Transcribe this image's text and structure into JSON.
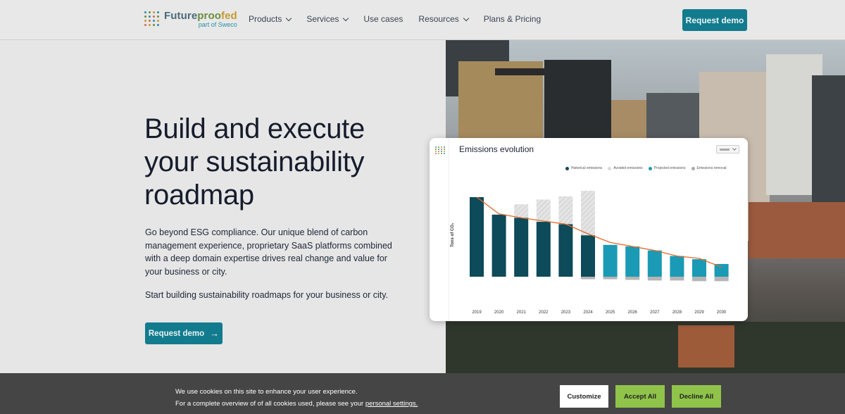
{
  "header": {
    "logo_main_1": "Future",
    "logo_main_2": "proo",
    "logo_main_3": "fed",
    "logo_sub": "part of Sweco",
    "nav": [
      {
        "label": "Products",
        "has_dropdown": true
      },
      {
        "label": "Services",
        "has_dropdown": true
      },
      {
        "label": "Use cases",
        "has_dropdown": false
      },
      {
        "label": "Resources",
        "has_dropdown": true
      },
      {
        "label": "Plans & Pricing",
        "has_dropdown": false
      }
    ],
    "cta_label": "Request demo"
  },
  "hero": {
    "title": "Build and execute your sustainability roadmap",
    "description": "Go beyond ESG compliance. Our unique blend of carbon management experience, proprietary SaaS platforms combined with a deep domain expertise drives real change and value for your business or city.",
    "description2": "Start building sustainability roadmaps for your business or city.",
    "cta_label": "Request demo",
    "cta_arrow": "→"
  },
  "card": {
    "title": "Emissions evolution",
    "ylabel": "Tons of CO₂",
    "legend": [
      {
        "label": "Historical emissions",
        "color": "#0d4a5a"
      },
      {
        "label": "Avoided emissions",
        "color": "#d9d9d9"
      },
      {
        "label": "Projected emissions",
        "color": "#1a9ab5"
      },
      {
        "label": "Emissions removal",
        "color": "#aaaaaa"
      }
    ]
  },
  "chart_data": {
    "type": "bar",
    "categories": [
      "2019",
      "2020",
      "2021",
      "2022",
      "2023",
      "2024",
      "2025",
      "2026",
      "2027",
      "2028",
      "2029",
      "2030"
    ],
    "series": [
      {
        "name": "Historical emissions",
        "values": [
          100,
          78,
          74,
          69,
          66,
          52,
          0,
          0,
          0,
          0,
          0,
          0
        ]
      },
      {
        "name": "Avoided emissions",
        "values": [
          0,
          0,
          17,
          28,
          35,
          56,
          0,
          0,
          0,
          0,
          0,
          0
        ]
      },
      {
        "name": "Projected emissions",
        "values": [
          0,
          0,
          0,
          0,
          0,
          0,
          40,
          38,
          33,
          26,
          22,
          16
        ]
      },
      {
        "name": "Emissions removal",
        "values": [
          0,
          0,
          0,
          0,
          0,
          4,
          4,
          5,
          6,
          6,
          7,
          7
        ]
      }
    ],
    "trend_line": [
      100,
      79,
      74,
      70,
      66,
      54,
      43,
      38,
      33,
      26,
      23,
      12
    ],
    "ylabel": "Tons of CO₂"
  },
  "cookie": {
    "line1": "We use cookies on this site to enhance your user experience.",
    "line2": "For a complete overview of of all cookies used, please see your",
    "link": "personal settings.",
    "customize": "Customize",
    "accept": "Accept All",
    "decline": "Decline All"
  },
  "colors": {
    "accent": "#137b8e",
    "trend": "#e06a2a",
    "cookie_green": "#8fc34a"
  }
}
